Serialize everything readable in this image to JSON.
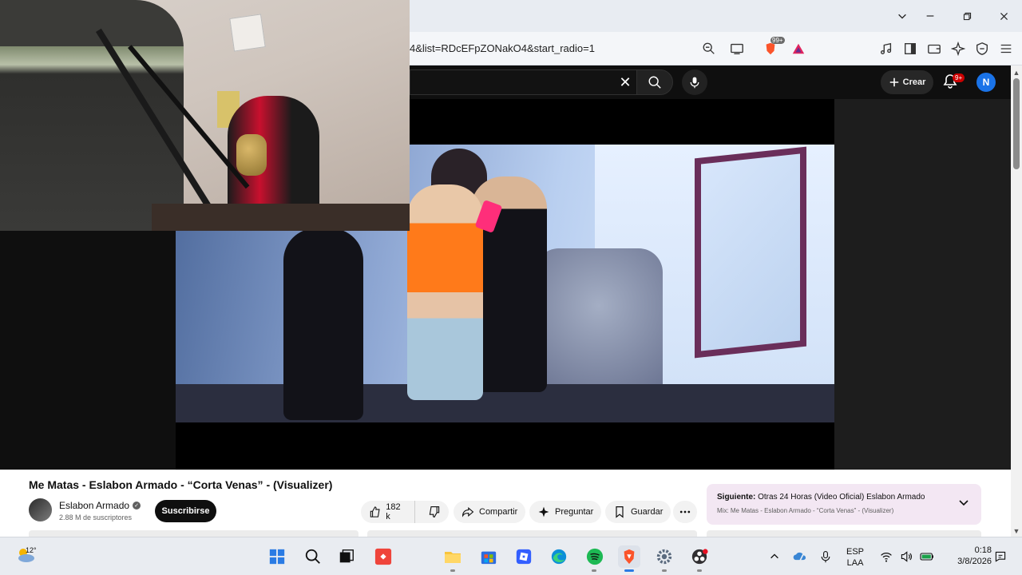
{
  "browser": {
    "url": "4&list=RDcEFpZONakO4&start_radio=1",
    "brave_badge": "99+"
  },
  "youtube": {
    "search_clear": "✕",
    "create_label": "Crear",
    "notif_badge": "9+",
    "avatar_letter": "N"
  },
  "video": {
    "title": "Me Matas - Eslabon Armado - “Corta Venas” - (Visualizer)",
    "channel": "Eslabon Armado",
    "subscribers": "2.88 M de suscriptores",
    "subscribe_label": "Suscribirse",
    "likes": "182 k",
    "share_label": "Compartir",
    "ask_label": "Preguntar",
    "save_label": "Guardar"
  },
  "next": {
    "label": "Siguiente:",
    "title": "Otras 24 Horas (Video Oficial) Eslabon Armado",
    "mix": "Mix: Me Matas - Eslabon Armado - “Corta Venas” - (Visualizer)"
  },
  "taskbar": {
    "weather_temp": "12°",
    "lang_line1": "ESP",
    "lang_line2": "LAA",
    "time": "0:18",
    "date": "3/8/2026"
  },
  "colors": {
    "yt_bg": "#0f0f0f",
    "subscribe_bg": "#0f0f0f",
    "next_card_bg": "#f3e7f3",
    "notif_red": "#cc0000",
    "avatar_blue": "#1a73e8"
  }
}
